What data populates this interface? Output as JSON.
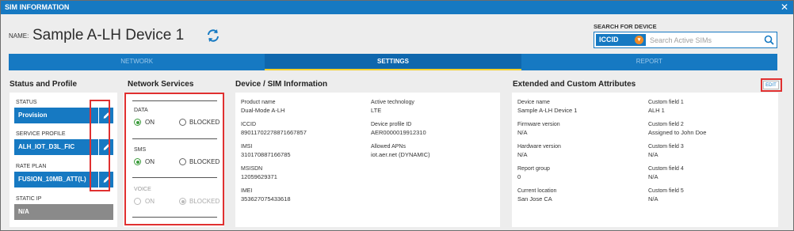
{
  "window": {
    "title": "SIM INFORMATION",
    "close_label": "✕"
  },
  "header": {
    "name_label": "NAME:",
    "device_name": "Sample A-LH Device 1",
    "search": {
      "title": "SEARCH FOR DEVICE",
      "type_label": "ICCID",
      "placeholder": "Search Active SIMs"
    }
  },
  "tabs": [
    {
      "label": "NETWORK",
      "active": false
    },
    {
      "label": "SETTINGS",
      "active": true
    },
    {
      "label": "REPORT",
      "active": false
    }
  ],
  "status_profile": {
    "title": "Status and Profile",
    "status": {
      "label": "STATUS",
      "value": "Provision"
    },
    "service_profile": {
      "label": "SERVICE PROFILE",
      "value": "ALH_IOT_D3L_FIC"
    },
    "rate_plan": {
      "label": "RATE PLAN",
      "value": "FUSION_10MB_ATT(L)"
    },
    "static_ip": {
      "label": "STATIC IP",
      "value": "N/A"
    }
  },
  "network_services": {
    "title": "Network Services",
    "on_label": "ON",
    "blocked_label": "BLOCKED",
    "groups": [
      {
        "label": "DATA",
        "selected": "ON",
        "disabled": false
      },
      {
        "label": "SMS",
        "selected": "ON",
        "disabled": false
      },
      {
        "label": "VOICE",
        "selected": "BLOCKED",
        "disabled": true
      }
    ]
  },
  "device_sim": {
    "title": "Device / SIM Information",
    "left": [
      {
        "label": "Product name",
        "value": "Dual-Mode A-LH"
      },
      {
        "label": "ICCID",
        "value": "89011702278871667857"
      },
      {
        "label": "IMSI",
        "value": "310170887166785"
      },
      {
        "label": "MSISDN",
        "value": "12059629371"
      },
      {
        "label": "IMEI",
        "value": "353627075433618"
      }
    ],
    "right": [
      {
        "label": "Active technology",
        "value": "LTE"
      },
      {
        "label": "Device profile ID",
        "value": "AER0000019912310"
      },
      {
        "label": "Allowed APNs",
        "value": "iot.aer.net (DYNAMIC)"
      }
    ]
  },
  "extended": {
    "title": "Extended and Custom Attributes",
    "edit_label": "EDIT",
    "left": [
      {
        "label": "Device name",
        "value": "Sample A-LH Device 1"
      },
      {
        "label": "Firmware version",
        "value": "N/A"
      },
      {
        "label": "Hardware version",
        "value": "N/A"
      },
      {
        "label": "Report group",
        "value": "0"
      },
      {
        "label": "Current location",
        "value": "San Jose CA"
      }
    ],
    "right": [
      {
        "label": "Custom field 1",
        "value": "ALH 1"
      },
      {
        "label": "Custom field 2",
        "value": "Assigned to John Doe"
      },
      {
        "label": "Custom field 3",
        "value": "N/A"
      },
      {
        "label": "Custom field 4",
        "value": "N/A"
      },
      {
        "label": "Custom field 5",
        "value": "N/A"
      }
    ]
  },
  "colors": {
    "accent": "#1679c2",
    "highlight": "#e03030",
    "tab_indicator": "#f4d02a",
    "on_radio": "#3a9b3a"
  }
}
